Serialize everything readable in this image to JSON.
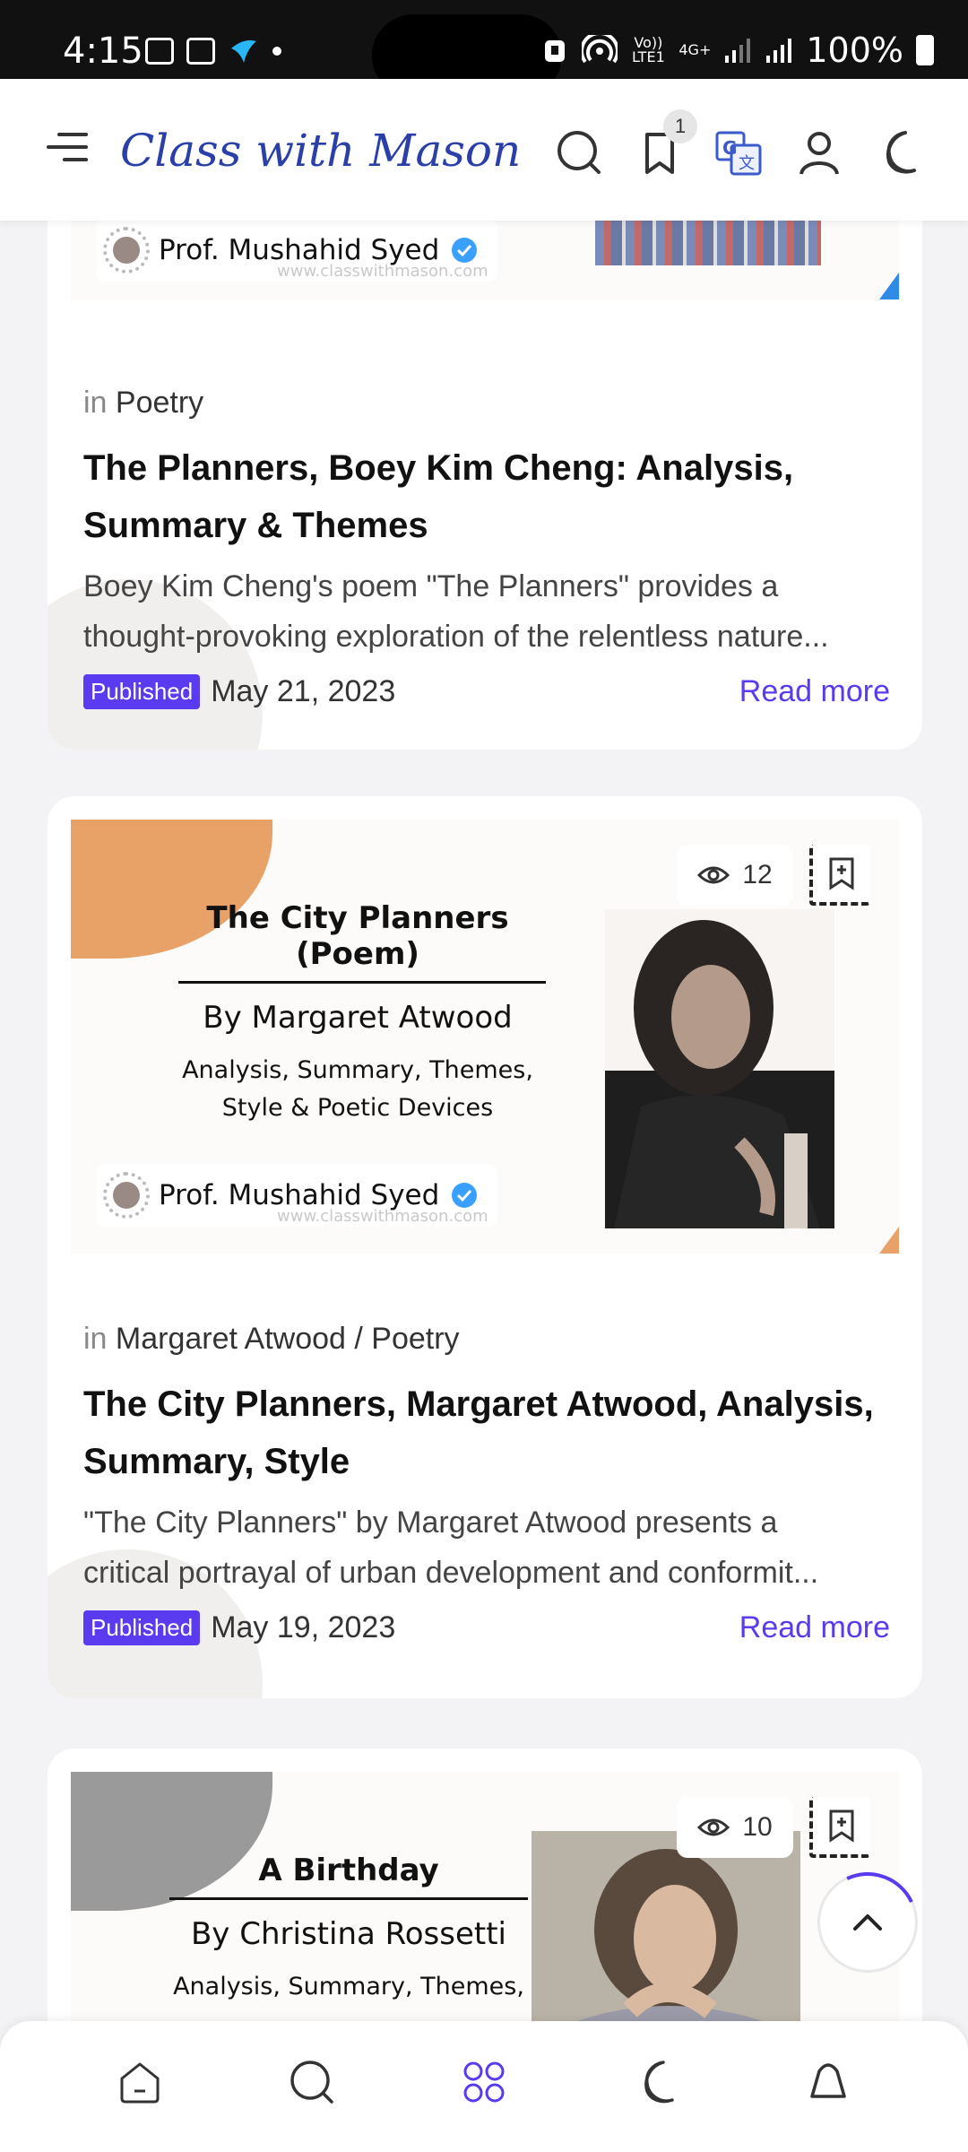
{
  "status_bar": {
    "time": "4:15",
    "battery": "100%",
    "network_top": "Vo)) LTE1",
    "network_4g": "4G+"
  },
  "header": {
    "logo_text": "Class with Mason",
    "bookmark_count": "1",
    "icons": [
      "menu-icon",
      "search-icon",
      "bookmark-icon",
      "translate-icon",
      "user-icon",
      "moon-icon"
    ]
  },
  "posts": [
    {
      "author": "Prof. Mushahid Syed",
      "watermark": "www.classwithmason.com",
      "category_prefix": "in",
      "category": "Poetry",
      "title": "The Planners, Boey Kim Cheng: Analysis, Summary & Themes",
      "excerpt_line1": "Boey Kim Cheng's poem \"The Planners\" provides a",
      "excerpt_line2": "thought-provoking exploration of the relentless nature...",
      "status": "Published",
      "date": "May 21, 2023",
      "read_more": "Read more"
    },
    {
      "views": "12",
      "thumb_title": "The City Planners (Poem)",
      "thumb_by": "By Margaret Atwood",
      "thumb_sub1": "Analysis, Summary, Themes,",
      "thumb_sub2": "Style & Poetic Devices",
      "author": "Prof. Mushahid Syed",
      "watermark": "www.classwithmason.com",
      "category_prefix": "in",
      "category": "Margaret Atwood / Poetry",
      "title": "The City Planners, Margaret Atwood, Analysis, Summary, Style",
      "excerpt_line1": "\"The City Planners\" by Margaret Atwood presents a",
      "excerpt_line2": "critical portrayal of urban development and conformit...",
      "status": "Published",
      "date": "May 19, 2023",
      "read_more": "Read more"
    },
    {
      "views": "10",
      "thumb_title": "A Birthday",
      "thumb_by": "By Christina Rossetti",
      "thumb_sub1": "Analysis, Summary, Themes,"
    }
  ],
  "colors": {
    "accent": "#5b3bf0",
    "orange_corner": "#e8a268",
    "grey_corner": "#9a9a9a",
    "header_bg": "#ffffff"
  },
  "bottom_nav": [
    "home-icon",
    "search-icon",
    "apps-icon",
    "moon-icon",
    "bell-icon"
  ]
}
